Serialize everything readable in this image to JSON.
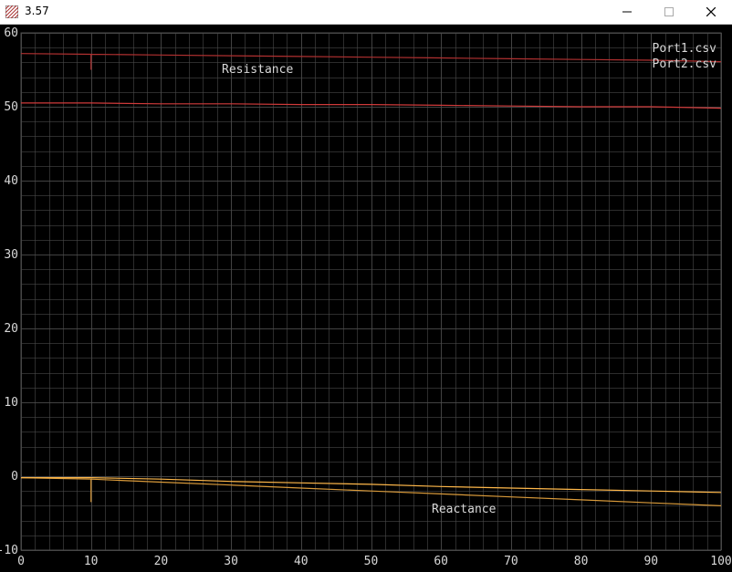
{
  "window": {
    "title": "3.57",
    "minimize_icon": "minimize-icon",
    "maximize_icon": "maximize-icon",
    "close_icon": "close-icon"
  },
  "colors": {
    "background": "#000000",
    "grid": "#4a4a4a",
    "text": "#d8d8d8",
    "resistance_port1": "#b03030",
    "resistance_port2": "#cf3a3a",
    "reactance_port1": "#d99a3a",
    "reactance_port2": "#ffb84a"
  },
  "chart_data": {
    "type": "line",
    "title": "",
    "xlabel": "",
    "ylabel": "",
    "xlim": [
      0,
      100
    ],
    "ylim": [
      -10,
      60
    ],
    "x_ticks": [
      0,
      10,
      20,
      30,
      40,
      50,
      60,
      70,
      80,
      90,
      100
    ],
    "y_ticks": [
      -10,
      0,
      10,
      20,
      30,
      40,
      50,
      60
    ],
    "grid": true,
    "legend": [
      "Port1.csv",
      "Port2.csv"
    ],
    "legend_position": "top-right",
    "annotations": [
      "Resistance",
      "Reactance"
    ],
    "series": [
      {
        "name": "Port1.csv",
        "group": "Resistance",
        "x": [
          0,
          10,
          10,
          10,
          20,
          30,
          40,
          50,
          60,
          70,
          80,
          90,
          100
        ],
        "y": [
          57.2,
          57.1,
          55.0,
          57.1,
          57.0,
          56.9,
          56.8,
          56.7,
          56.6,
          56.5,
          56.4,
          56.3,
          56.1
        ]
      },
      {
        "name": "Port2.csv",
        "group": "Resistance",
        "x": [
          0,
          10,
          20,
          30,
          40,
          50,
          60,
          70,
          80,
          90,
          100
        ],
        "y": [
          50.5,
          50.5,
          50.4,
          50.4,
          50.3,
          50.3,
          50.2,
          50.1,
          50.0,
          50.0,
          49.8
        ]
      },
      {
        "name": "Port1.csv",
        "group": "Reactance",
        "x": [
          0,
          10,
          10,
          10,
          20,
          30,
          40,
          50,
          60,
          70,
          80,
          90,
          100
        ],
        "y": [
          -0.2,
          -0.4,
          -3.5,
          -0.4,
          -0.8,
          -1.2,
          -1.6,
          -2.0,
          -2.4,
          -2.8,
          -3.2,
          -3.6,
          -4.0
        ]
      },
      {
        "name": "Port2.csv",
        "group": "Reactance",
        "x": [
          0,
          10,
          20,
          30,
          40,
          50,
          60,
          70,
          80,
          90,
          100
        ],
        "y": [
          -0.2,
          -0.2,
          -0.4,
          -0.7,
          -0.9,
          -1.1,
          -1.4,
          -1.6,
          -1.8,
          -2.0,
          -2.2
        ]
      }
    ]
  }
}
